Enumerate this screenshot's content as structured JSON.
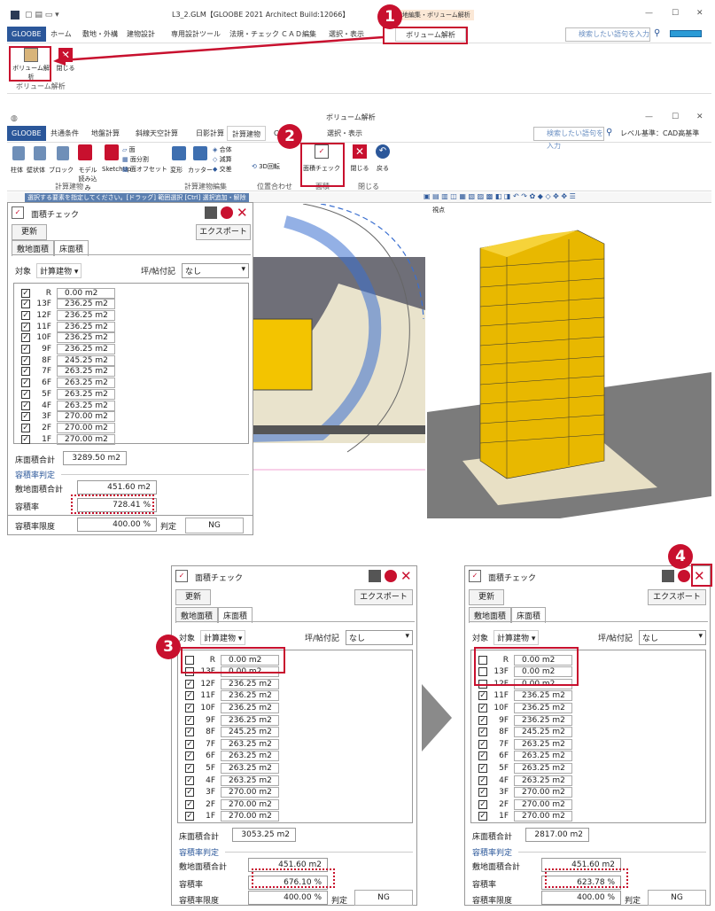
{
  "top": {
    "title": "L3_2.GLM【GLOOBE 2021 Architect Build:12066】",
    "context_tab": "敷地編集・ボリューム解析",
    "tabs": [
      "GLOOBE",
      "ホーム",
      "敷地・外構",
      "建物設計",
      "専用設計ツール",
      "法規・チェック",
      "ＣＡＤ編集",
      "選択・表示",
      "ボリューム解析"
    ],
    "search_placeholder": "検索したい語句を入力",
    "btn_volume": "ボリューム解析",
    "btn_close": "閉じる",
    "group": "ボリューム解析"
  },
  "ribbon2": {
    "title": "ボリューム解析",
    "tabs": [
      "GLOOBE",
      "共通条件",
      "地盤計算",
      "斜線天空計算",
      "日影計算",
      "計算建物",
      "C",
      "選択・表示"
    ],
    "search_placeholder": "検索したい語句を入力",
    "level": "レベル基準：CAD高基準",
    "buttons": [
      "柱体",
      "壁状体",
      "ブロック",
      "モデル読み込み",
      "SketchUp",
      "面",
      "面分割",
      "面オフセット",
      "変形",
      "カッター",
      "合体",
      "減算",
      "交差",
      "3D回転",
      "面積チェック",
      "閉じる",
      "戻る"
    ],
    "groups": [
      "計算建物",
      "計算建物編集",
      "位置合わせ",
      "面積",
      "閉じる"
    ],
    "status": "選択する要素を指定してください。[ドラッグ] 範囲選択 [Ctrl] 選択追加・解除",
    "view": "視点"
  },
  "dialog": {
    "title": "面積チェック",
    "update": "更新",
    "export": "エクスポート",
    "tab1": "敷地面積",
    "tab2": "床面積",
    "target_label": "対象",
    "target_value": "計算建物",
    "tsubo_label": "坪/帖付記",
    "tsubo_value": "なし",
    "total_label": "床面積合計",
    "judge_label": "容積率判定",
    "site_label": "敷地面積合計",
    "ratio_label": "容積率",
    "limit_label": "容積率限度",
    "judge_word": "判定"
  },
  "d1": {
    "rows": [
      [
        "R",
        "0.00",
        "m2"
      ],
      [
        "13F",
        "236.25",
        "m2"
      ],
      [
        "12F",
        "236.25",
        "m2"
      ],
      [
        "11F",
        "236.25",
        "m2"
      ],
      [
        "10F",
        "236.25",
        "m2"
      ],
      [
        "9F",
        "236.25",
        "m2"
      ],
      [
        "8F",
        "245.25",
        "m2"
      ],
      [
        "7F",
        "263.25",
        "m2"
      ],
      [
        "6F",
        "263.25",
        "m2"
      ],
      [
        "5F",
        "263.25",
        "m2"
      ],
      [
        "4F",
        "263.25",
        "m2"
      ],
      [
        "3F",
        "270.00",
        "m2"
      ],
      [
        "2F",
        "270.00",
        "m2"
      ],
      [
        "1F",
        "270.00",
        "m2"
      ]
    ],
    "total": "3289.50 m2",
    "site": "451.60 m2",
    "ratio": "728.41 %",
    "limit": "400.00 %",
    "result": "NG"
  },
  "d2": {
    "total": "3053.25 m2",
    "site": "451.60 m2",
    "ratio": "676.10 %",
    "limit": "400.00 %",
    "result": "NG",
    "r13": "13F",
    "v13": "0.00",
    "r12": "12F",
    "v12": "236.25"
  },
  "d3": {
    "total": "2817.00 m2",
    "site": "451.60 m2",
    "ratio": "623.78 %",
    "limit": "400.00 %",
    "result": "NG"
  },
  "badges": [
    "1",
    "2",
    "3",
    "4"
  ]
}
